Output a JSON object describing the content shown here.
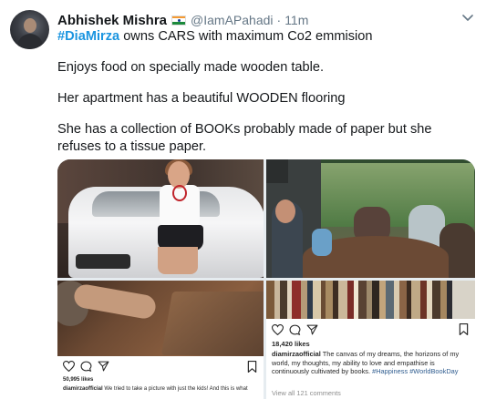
{
  "tweet": {
    "author_name": "Abhishek Mishra",
    "author_handle": "@IamAPahadi",
    "separator": "·",
    "time": "11m",
    "line1_hashtag": "#DiaMirza",
    "line1_rest": " owns CARS with maximum Co2 emmision",
    "line2": "Enjoys food on specially made wooden table.",
    "line3": "Her apartment has a beautiful WOODEN flooring",
    "line4": "She has a collection of BOOKs probably made of paper but she refuses to a tissue paper."
  },
  "icons": {
    "flag": "india-flag-icon",
    "more": "chevron-down-icon",
    "like": "heart-icon",
    "comment": "comment-icon",
    "share": "send-icon",
    "save": "bookmark-icon"
  },
  "media": {
    "images": [
      {
        "description_name": "car-photo"
      },
      {
        "description_name": "dining-photo"
      },
      {
        "description_name": "instagram-post-floor"
      },
      {
        "description_name": "instagram-post-books"
      }
    ],
    "insta_left": {
      "likes": "50,995 likes",
      "username": "diamirzaofficial",
      "caption": " We tried to take a picture with just the kids! And this is what"
    },
    "insta_right": {
      "likes": "18,420 likes",
      "username": "diamirzaofficial",
      "caption": " The canvas of my dreams, the horizons of my world, my thoughts, my ability to love and empathise is continuously cultivated by books. ",
      "tags": "#Happiness #WorldBookDay",
      "comments": "View all 121 comments"
    }
  },
  "colors": {
    "link": "#1b95e0",
    "muted": "#657786",
    "text": "#14171a"
  }
}
